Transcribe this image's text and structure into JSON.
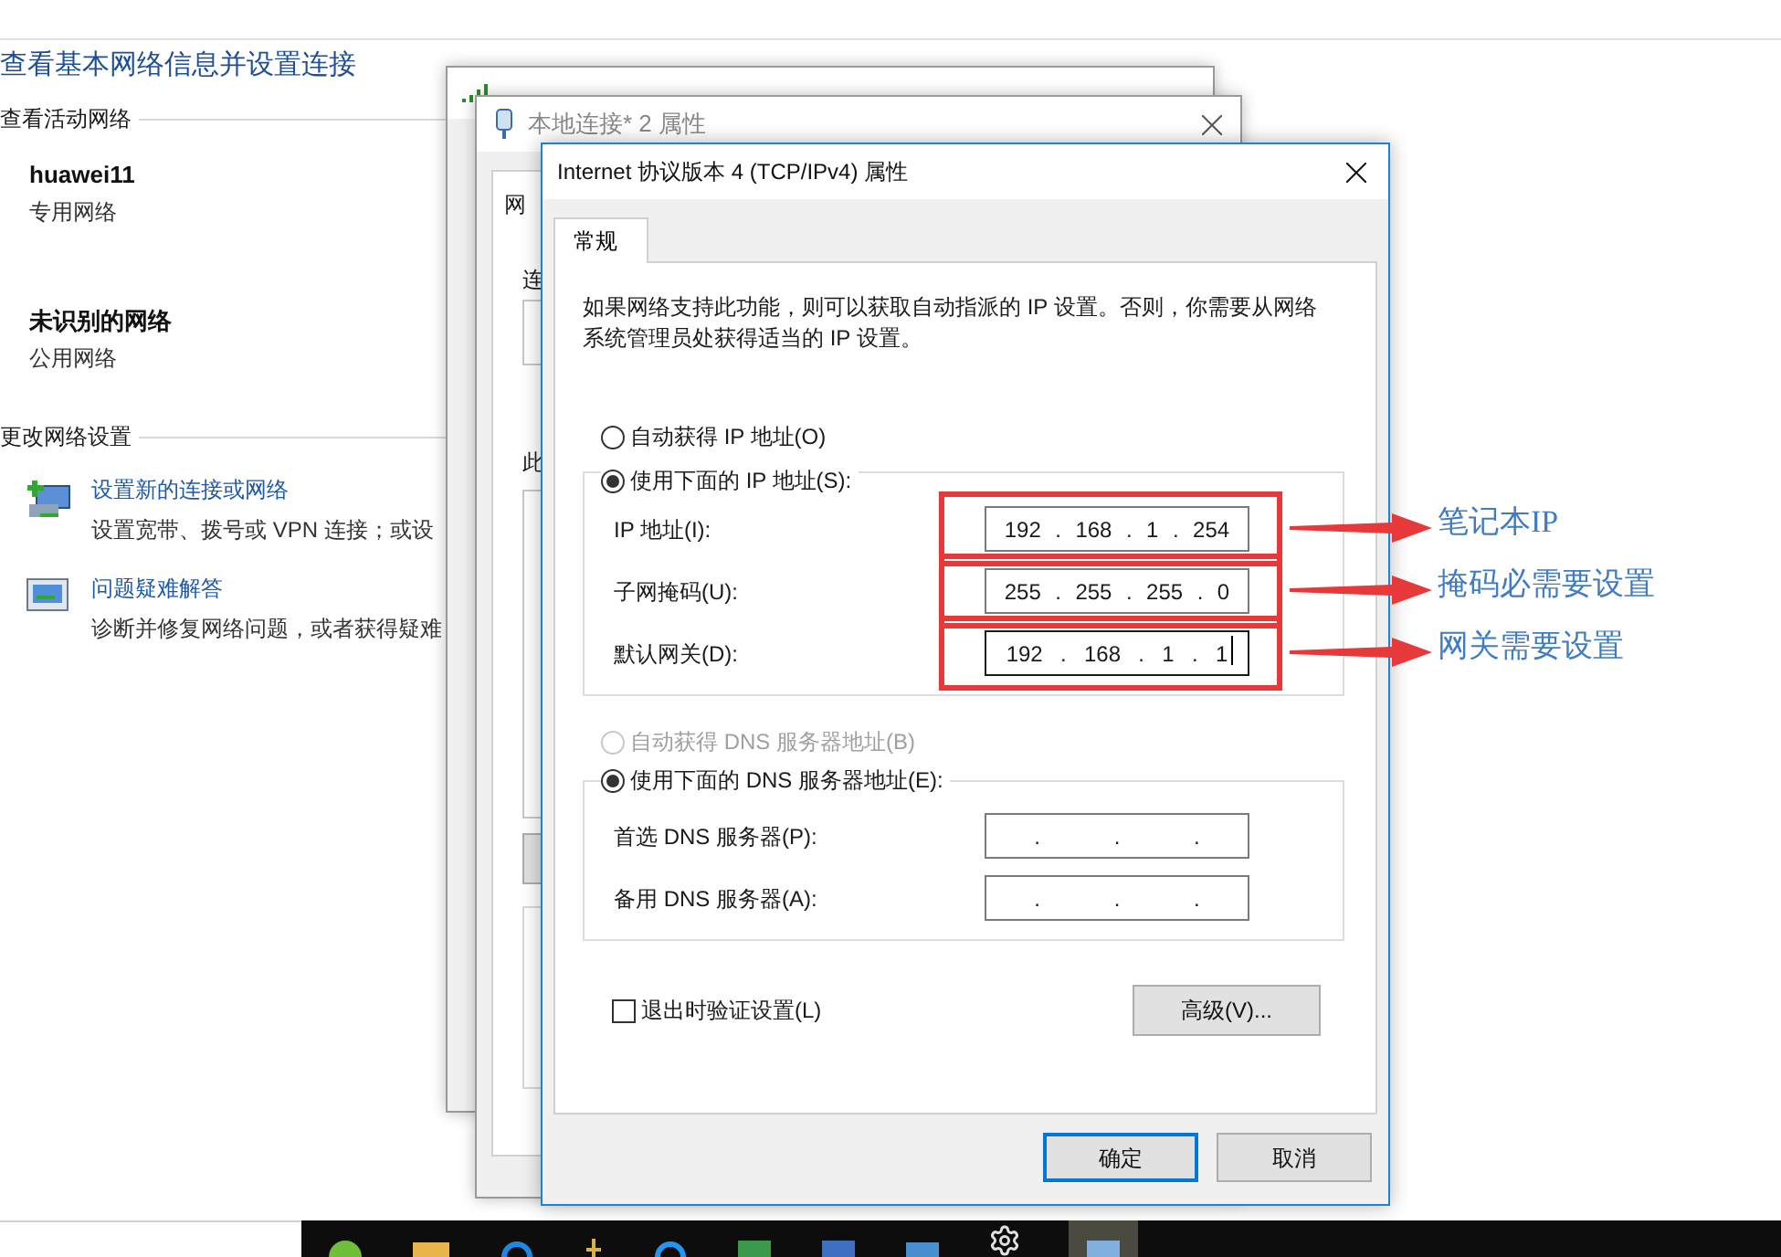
{
  "network_center": {
    "heading": "查看基本网络信息并设置连接",
    "active_section": "查看活动网络",
    "networks": [
      {
        "name": "huawei11",
        "type": "专用网络"
      },
      {
        "name": "未识别的网络",
        "type": "公用网络"
      }
    ],
    "settings_section": "更改网络设置",
    "tasks": [
      {
        "kind": "setup",
        "link": "设置新的连接或网络",
        "description": "设置宽带、拨号或 VPN 连接；或设"
      },
      {
        "kind": "troubleshoot",
        "link": "问题疑难解答",
        "description": "诊断并修复网络问题，或者获得疑难"
      }
    ]
  },
  "properties_window": {
    "title": "本地连接* 2 属性",
    "fragments": [
      "网",
      "连",
      "此"
    ]
  },
  "dialog": {
    "title": "Internet 协议版本 4 (TCP/IPv4) 属性",
    "tabs": [
      {
        "label": "常规",
        "selected": true
      }
    ],
    "intro": "如果网络支持此功能，则可以获取自动指派的 IP 设置。否则，你需要从网络系统管理员处获得适当的 IP 设置。",
    "ip_modes": [
      {
        "label": "自动获得 IP 地址(O)",
        "selected": false,
        "disabled": false
      },
      {
        "label": "使用下面的 IP 地址(S):",
        "selected": true,
        "disabled": false
      }
    ],
    "ip_fields": [
      {
        "label": "IP 地址(I):",
        "segments": [
          "192",
          ".",
          "168",
          ".",
          "1",
          ".",
          "254"
        ],
        "focused": false,
        "annotation": "笔记本IP"
      },
      {
        "label": "子网掩码(U):",
        "segments": [
          "255",
          ".",
          "255",
          ".",
          "255",
          ".",
          "0"
        ],
        "focused": false,
        "annotation": "掩码必需要设置"
      },
      {
        "label": "默认网关(D):",
        "segments": [
          "192",
          ".",
          "168",
          ".",
          "1",
          ".",
          "1"
        ],
        "focused": true,
        "annotation": "网关需要设置"
      }
    ],
    "dns_modes": [
      {
        "label": "自动获得 DNS 服务器地址(B)",
        "selected": false,
        "disabled": true
      },
      {
        "label": "使用下面的 DNS 服务器地址(E):",
        "selected": true,
        "disabled": false
      }
    ],
    "dns_fields": [
      {
        "label": "首选 DNS 服务器(P):",
        "segments": [
          ".",
          ".",
          "."
        ]
      },
      {
        "label": "备用 DNS 服务器(A):",
        "segments": [
          ".",
          ".",
          "."
        ]
      }
    ],
    "validate": {
      "label": "退出时验证设置(L)",
      "checked": false
    },
    "advanced_button": "高级(V)...",
    "buttons": [
      {
        "label": "确定",
        "default": true
      },
      {
        "label": "取消",
        "default": false
      }
    ]
  }
}
